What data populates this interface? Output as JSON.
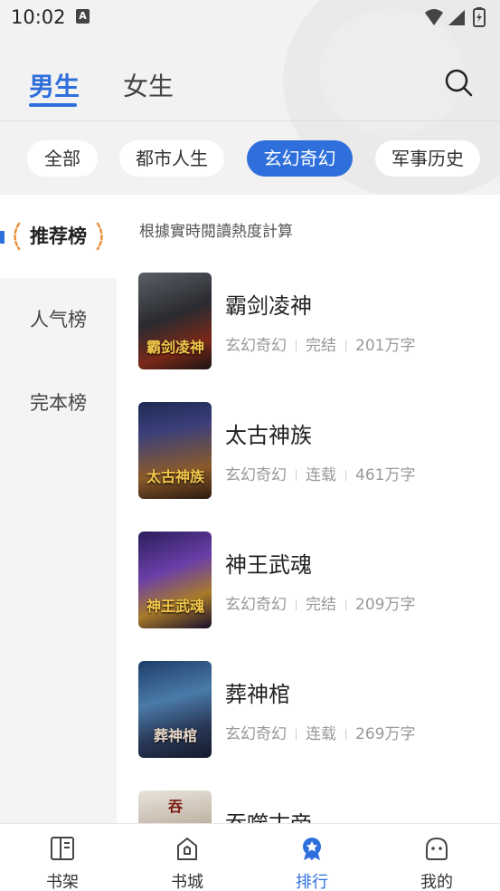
{
  "status_bar": {
    "time": "10:02",
    "notification_icon": "A"
  },
  "gender_tabs": {
    "male": "男生",
    "female": "女生",
    "active": "男生"
  },
  "categories": [
    {
      "label": "全部",
      "active": false
    },
    {
      "label": "都市人生",
      "active": false
    },
    {
      "label": "玄幻奇幻",
      "active": true
    },
    {
      "label": "军事历史",
      "active": false
    }
  ],
  "rank_menu": [
    {
      "label": "推荐榜",
      "active": true
    },
    {
      "label": "人气榜",
      "active": false
    },
    {
      "label": "完本榜",
      "active": false
    }
  ],
  "list_caption": "根據實時閱讀熱度計算",
  "books": [
    {
      "title": "霸剑凌神",
      "genre": "玄幻奇幻",
      "status": "完结",
      "words": "201万字",
      "cover_text": "霸剑凌神"
    },
    {
      "title": "太古神族",
      "genre": "玄幻奇幻",
      "status": "连载",
      "words": "461万字",
      "cover_text": "太古神族"
    },
    {
      "title": "神王武魂",
      "genre": "玄幻奇幻",
      "status": "完结",
      "words": "209万字",
      "cover_text": "神王武魂"
    },
    {
      "title": "葬神棺",
      "genre": "玄幻奇幻",
      "status": "连载",
      "words": "269万字",
      "cover_text": "葬神棺"
    },
    {
      "title": "吞噬古帝",
      "genre": "",
      "status": "",
      "words": "",
      "cover_text": "吞"
    }
  ],
  "bottom_nav": [
    {
      "label": "书架",
      "icon": "bookshelf-icon",
      "active": false
    },
    {
      "label": "书城",
      "icon": "bookstore-icon",
      "active": false
    },
    {
      "label": "排行",
      "icon": "ranking-icon",
      "active": true
    },
    {
      "label": "我的",
      "icon": "profile-icon",
      "active": false
    }
  ],
  "colors": {
    "accent": "#2f6fdb",
    "laurel": "#e8913a"
  }
}
